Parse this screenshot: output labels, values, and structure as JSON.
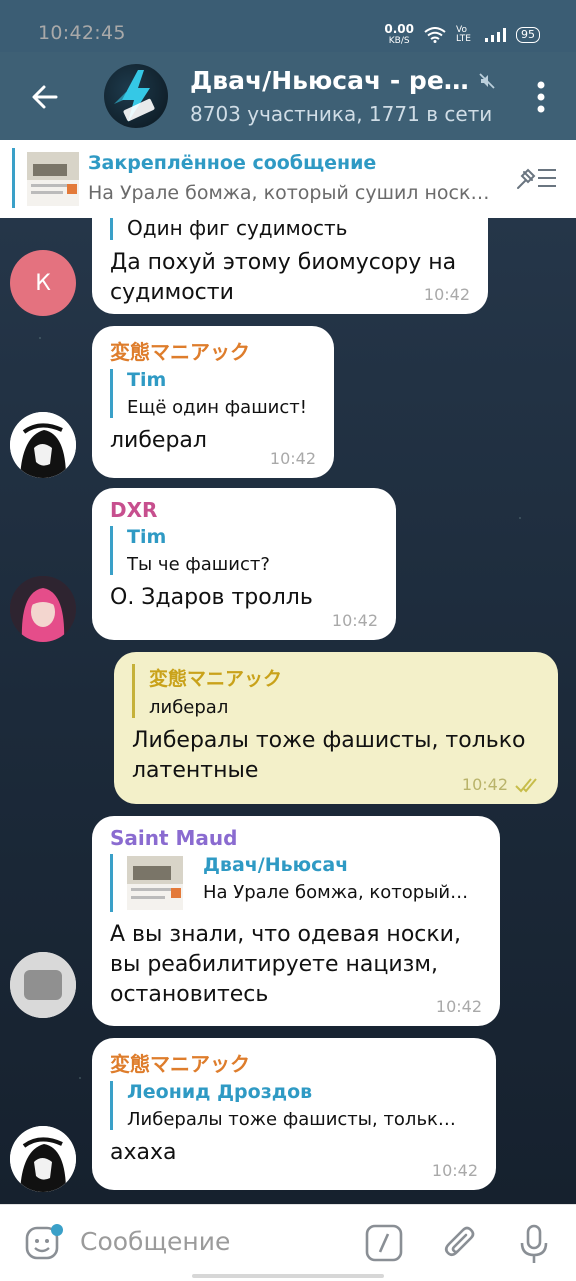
{
  "status": {
    "time": "10:42:45",
    "speed": "0.00",
    "speed_unit": "KB/S",
    "network": "Vo LTE",
    "battery": "95"
  },
  "header": {
    "title": "Двач/Ньюсач - ред…",
    "subtitle": "8703 участника, 1771 в сети"
  },
  "pinned": {
    "title": "Закреплённое сообщение",
    "text": "На Урале бомжа, который сушил носк…"
  },
  "messages": [
    {
      "reply_text": "Один фиг судимость",
      "text": "Да похуй этому биомусору на судимости",
      "time": "10:42",
      "avatar_letter": "К"
    },
    {
      "sender": "変態マニアック",
      "reply_name": "Tim",
      "reply_text": "Ещё один фашист!",
      "text": "либерал",
      "time": "10:42"
    },
    {
      "sender": "DXR",
      "reply_name": "Tim",
      "reply_text": "Ты че фашист?",
      "text": "О. Здаров тролль",
      "time": "10:42"
    },
    {
      "reply_name": "変態マニアック",
      "reply_text": "либерал",
      "text": "Либералы тоже фашисты, только латентные",
      "time": "10:42"
    },
    {
      "sender": "Saint Maud",
      "reply_name": "Двач/Ньюсач",
      "reply_text": "На Урале бомжа, который…",
      "text": "А вы знали, что одевая носки, вы реабилитируете нацизм, остановитесь",
      "time": "10:42"
    },
    {
      "sender": "変態マニアック",
      "reply_name": "Леонид Дроздов",
      "reply_text": "Либералы тоже фашисты, тольк…",
      "text": "ахаха",
      "time": "10:42"
    }
  ],
  "composer": {
    "placeholder": "Сообщение"
  },
  "colors": {
    "appbar": "#3e6075",
    "accent": "#2f9ac4",
    "own_bubble": "#f3f0c9",
    "avatar_k": "#e4727f",
    "sender_orange": "#de7d2c",
    "sender_pink": "#c74f8e",
    "sender_purple": "#8a6bd0"
  },
  "icons": [
    "back-icon",
    "mute-icon",
    "more-vert-icon",
    "unpin-icon",
    "emoji-icon",
    "command-icon",
    "attach-icon",
    "mic-icon",
    "double-check-icon"
  ]
}
